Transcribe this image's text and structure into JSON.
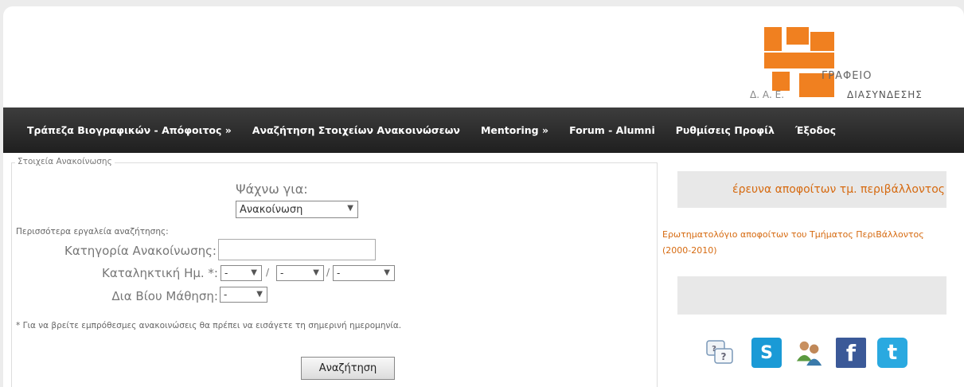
{
  "header": {
    "logo_text_primary": "ΓΡΑΦΕΙΟ",
    "logo_text_secondary": "ΔΙΑΣΥΝΔΕΣΗΣ",
    "logo_text_tertiary": "Δ.        Α.          Ε."
  },
  "nav": {
    "items": [
      {
        "label": "Τράπεζα Βιογραφικών - Απόφοιτος »"
      },
      {
        "label": "Αναζήτηση Στοιχείων Ανακοινώσεων"
      },
      {
        "label": "Mentoring »"
      },
      {
        "label": "Forum - Alumni"
      },
      {
        "label": "Ρυθμίσεις Προφίλ"
      },
      {
        "label": "Έξοδος"
      }
    ]
  },
  "form": {
    "legend": "Στοιχεία Ανακοίνωσης",
    "search_for_label": "Ψάχνω για:",
    "search_for_value": "Ανακοίνωση",
    "more_tools_label": "Περισσότερα εργαλεία αναζήτησης:",
    "category_label": "Κατηγορία Ανακοίνωσης:",
    "category_value": "",
    "deadline_label": "Καταληκτική Ημ. *:",
    "deadline_day": "-",
    "deadline_month": "-",
    "deadline_year": "-",
    "separator": "/",
    "lifelong_label": "Δια Βίου Μάθηση:",
    "lifelong_value": "-",
    "note": "* Για να βρείτε εμπρόθεσμες ανακοινώσεις θα πρέπει να εισάγετε τη σημερινή ημερομηνία.",
    "submit_label": "Αναζήτηση"
  },
  "sidebar": {
    "box1_text": "έρευνα αποφοίτων τμ. περιβάλλοντος",
    "link_text": "Ερωτηματολόγιο αποφοίτων του Τμήματος ΠεριΒάλλοντος (2000-2010)",
    "social_icons": [
      {
        "name": "questionnaire-icon"
      },
      {
        "name": "skype-icon",
        "glyph": "S"
      },
      {
        "name": "users-icon"
      },
      {
        "name": "facebook-icon",
        "glyph": "f"
      },
      {
        "name": "twitter-icon",
        "glyph": "t"
      }
    ]
  },
  "colors": {
    "accent": "#d66a10",
    "logo": "#f08020",
    "nav_bg": "#2b2b2b"
  }
}
